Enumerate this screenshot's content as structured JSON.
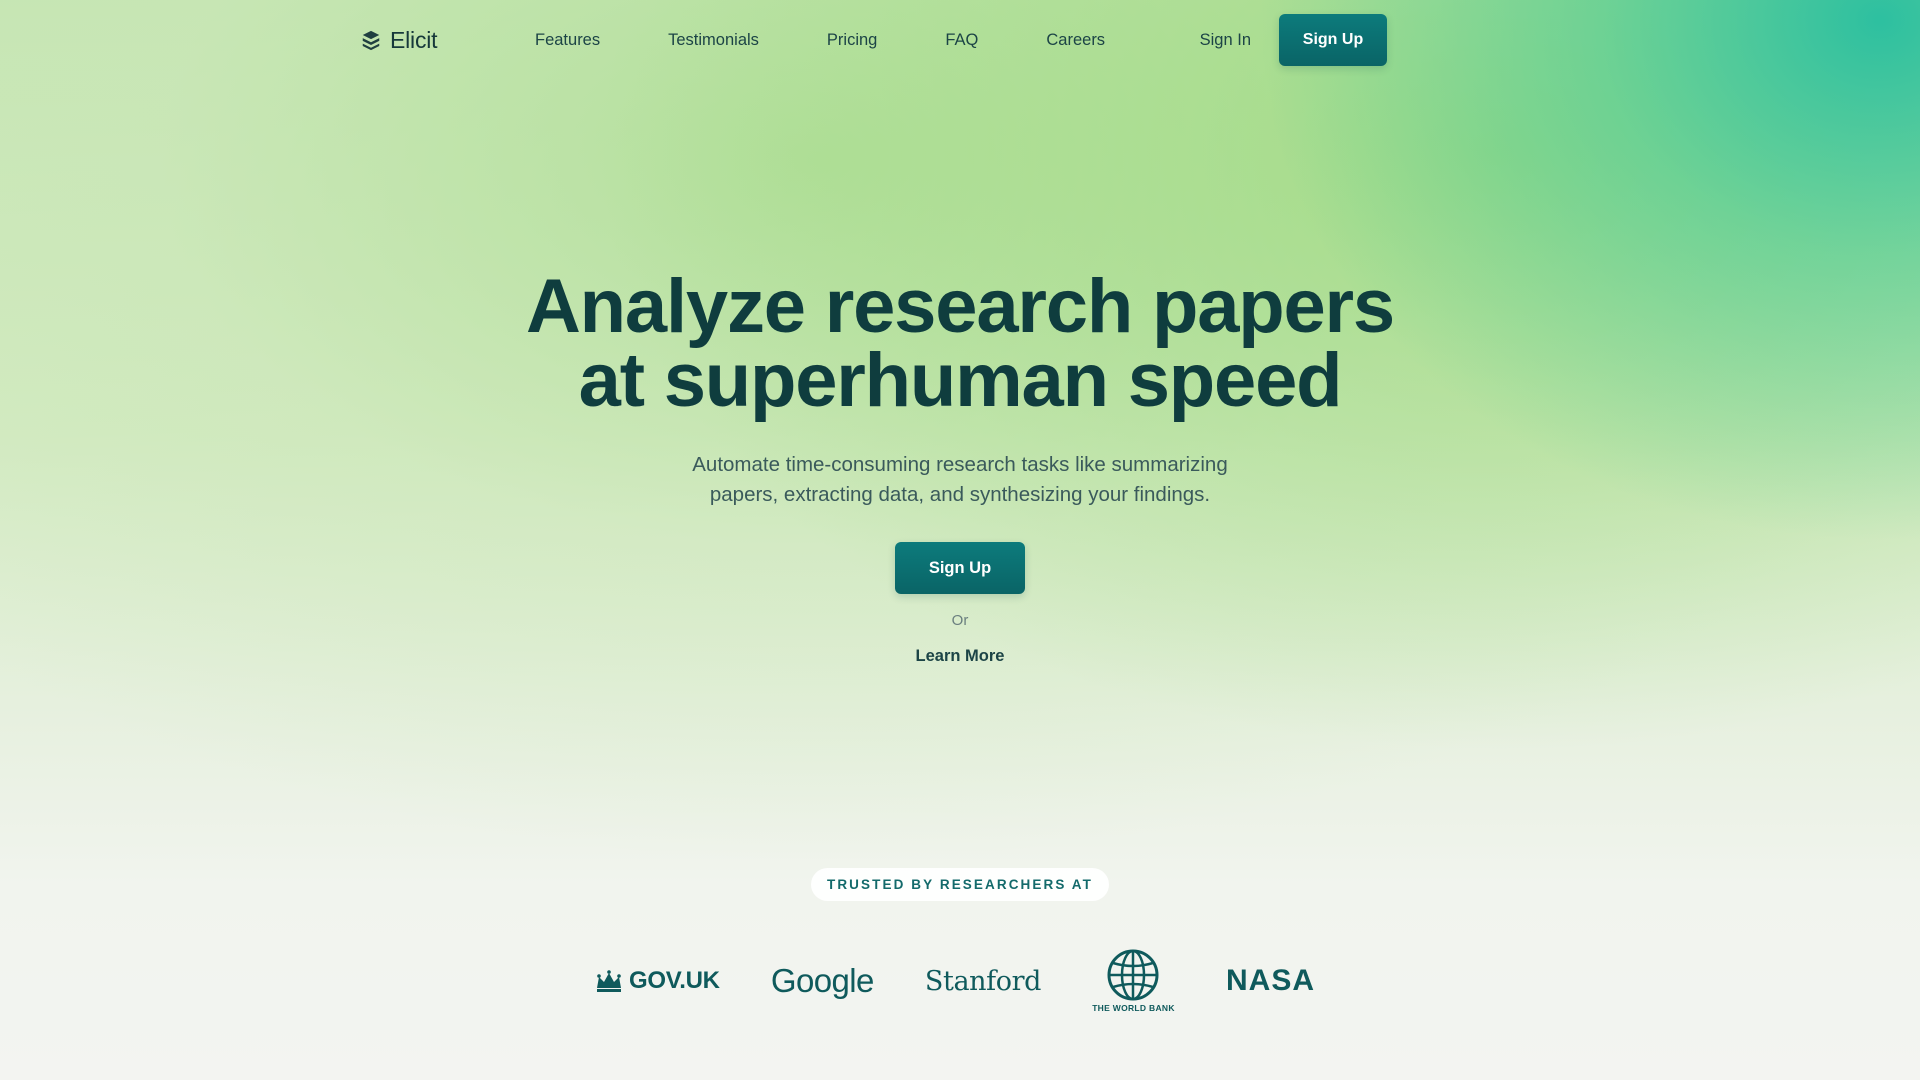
{
  "brand": {
    "name": "Elicit",
    "logo_icon": "elicit-logo-icon"
  },
  "nav": {
    "links": [
      "Features",
      "Testimonials",
      "Pricing",
      "FAQ",
      "Careers"
    ],
    "sign_in": "Sign In",
    "sign_up": "Sign Up"
  },
  "hero": {
    "title_line1": "Analyze research papers",
    "title_line2": "at superhuman speed",
    "subtitle_line1": "Automate time-consuming research tasks like summarizing",
    "subtitle_line2": "papers, extracting data, and synthesizing your findings.",
    "cta": "Sign Up",
    "or": "Or",
    "learn_more": "Learn More"
  },
  "trusted": {
    "label": "TRUSTED BY RESEARCHERS AT",
    "logos": {
      "govuk": "GOV.UK",
      "google": "Google",
      "stanford": "Stanford",
      "worldbank": "THE WORLD BANK",
      "nasa": "NASA"
    }
  },
  "colors": {
    "primary": "#0a6e70",
    "text_dark": "#0f3d3e",
    "logo_teal": "#0f5a5c"
  }
}
